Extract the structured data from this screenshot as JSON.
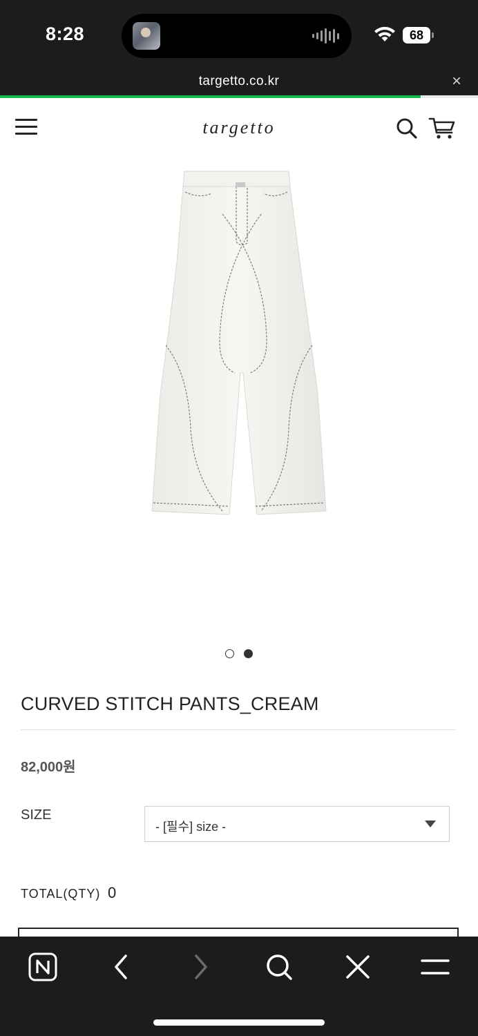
{
  "status_bar": {
    "time": "8:28",
    "battery": "68",
    "icons": [
      "album-thumbnail",
      "waveform-icon",
      "wifi-icon",
      "battery-icon"
    ]
  },
  "browser": {
    "url": "targetto.co.kr",
    "close_icon": "×",
    "page_load_progress": 0.88,
    "accent_color": "#19b84e"
  },
  "site_header": {
    "logo": "targetto",
    "icons": [
      "menu-icon",
      "search-icon",
      "cart-icon"
    ]
  },
  "carousel": {
    "total_slides": 2,
    "active_slide": 2
  },
  "product": {
    "title": "CURVED STITCH PANTS_CREAM",
    "price": "82,000원",
    "size_label": "SIZE",
    "size_select_value": "- [필수] size -",
    "total_label": "TOTAL(QTY)",
    "total_qty": "0"
  },
  "bottom_toolbar": {
    "buttons": [
      "naver-home-icon",
      "back-icon",
      "forward-icon",
      "search-icon",
      "close-icon",
      "menu-icon"
    ]
  }
}
